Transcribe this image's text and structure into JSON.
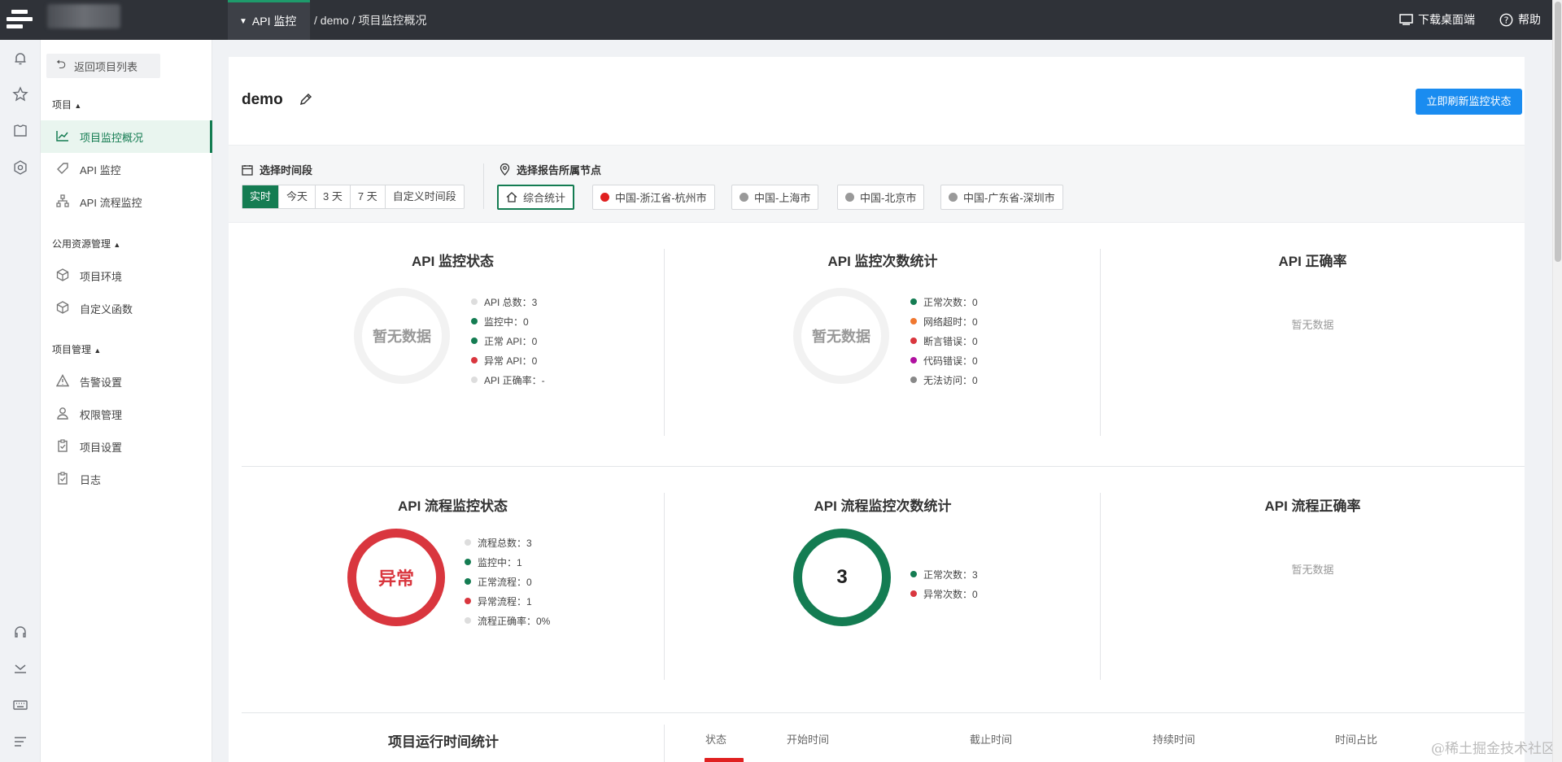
{
  "topbar": {
    "nav_label": "API 监控",
    "breadcrumb": "/ demo / 项目监控概况",
    "download_label": "下载桌面端",
    "help_label": "帮助"
  },
  "sidebar": {
    "back_label": "返回项目列表",
    "group1": "项目",
    "items1": [
      {
        "label": "项目监控概况"
      },
      {
        "label": "API 监控"
      },
      {
        "label": "API 流程监控"
      }
    ],
    "group2": "公用资源管理",
    "items2": [
      {
        "label": "项目环境"
      },
      {
        "label": "自定义函数"
      }
    ],
    "group3": "项目管理",
    "items3": [
      {
        "label": "告警设置"
      },
      {
        "label": "权限管理"
      },
      {
        "label": "项目设置"
      },
      {
        "label": "日志"
      }
    ]
  },
  "header": {
    "project_name": "demo",
    "refresh_label": "立即刷新监控状态"
  },
  "filters": {
    "time_label": "选择时间段",
    "time_options": [
      "实时",
      "今天",
      "3 天",
      "7 天",
      "自定义时间段"
    ],
    "node_label": "选择报告所属节点",
    "nodes": [
      "综合统计",
      "中国-浙江省-杭州市",
      "中国-上海市",
      "中国-北京市",
      "中国-广东省-深圳市"
    ],
    "colors": {
      "active": "#147c52",
      "hangzhou": "#e02020",
      "gray": "#999999"
    }
  },
  "panels": {
    "api_status": {
      "title": "API 监控状态",
      "center": "暂无数据",
      "legend": [
        "API 总数：3",
        "监控中：0",
        "正常 API：0",
        "异常 API：0",
        "API 正确率：-"
      ]
    },
    "api_count": {
      "title": "API 监控次数统计",
      "center": "暂无数据",
      "legend": [
        "正常次数：0",
        "网络超时：0",
        "断言错误：0",
        "代码错误：0",
        "无法访问：0"
      ]
    },
    "api_rate": {
      "title": "API 正确率",
      "nodata": "暂无数据"
    },
    "flow_status": {
      "title": "API 流程监控状态",
      "center": "异常",
      "legend": [
        "流程总数：3",
        "监控中：1",
        "正常流程：0",
        "异常流程：1",
        "流程正确率：0%"
      ]
    },
    "flow_count": {
      "title": "API 流程监控次数统计",
      "center": "3",
      "legend": [
        "正常次数：3",
        "异常次数：0"
      ]
    },
    "flow_rate": {
      "title": "API 流程正确率",
      "nodata": "暂无数据"
    }
  },
  "runtime": {
    "title": "项目运行时间统计",
    "columns": [
      "状态",
      "开始时间",
      "截止时间",
      "持续时间",
      "时间占比"
    ]
  },
  "watermark": "@稀土掘金技术社区"
}
